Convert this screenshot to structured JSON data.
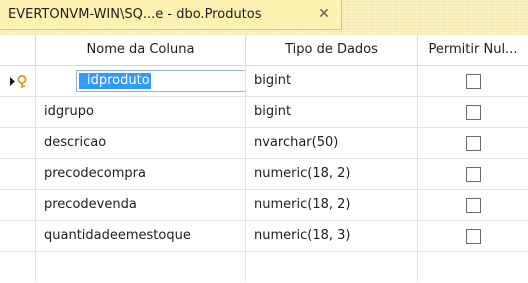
{
  "tab": {
    "title": "EVERTONVM-WIN\\SQ...e - dbo.Produtos",
    "close_glyph": "✕"
  },
  "columns": {
    "name": "Nome da Coluna",
    "type": "Tipo de Dados",
    "nullable": "Permitir Nul..."
  },
  "rows": [
    {
      "name": "idproduto",
      "type": "bigint",
      "allow_nulls": false,
      "primary_key": true,
      "selected": true
    },
    {
      "name": "idgrupo",
      "type": "bigint",
      "allow_nulls": false
    },
    {
      "name": "descricao",
      "type": "nvarchar(50)",
      "allow_nulls": false
    },
    {
      "name": "precodecompra",
      "type": "numeric(18, 2)",
      "allow_nulls": false
    },
    {
      "name": "precodevenda",
      "type": "numeric(18, 2)",
      "allow_nulls": false
    },
    {
      "name": "quantidadeemestoque",
      "type": "numeric(18, 3)",
      "allow_nulls": false
    }
  ],
  "colors": {
    "tab_background": "#fdf2b1",
    "selection": "#3399ff",
    "key_icon": "#d4a017"
  }
}
